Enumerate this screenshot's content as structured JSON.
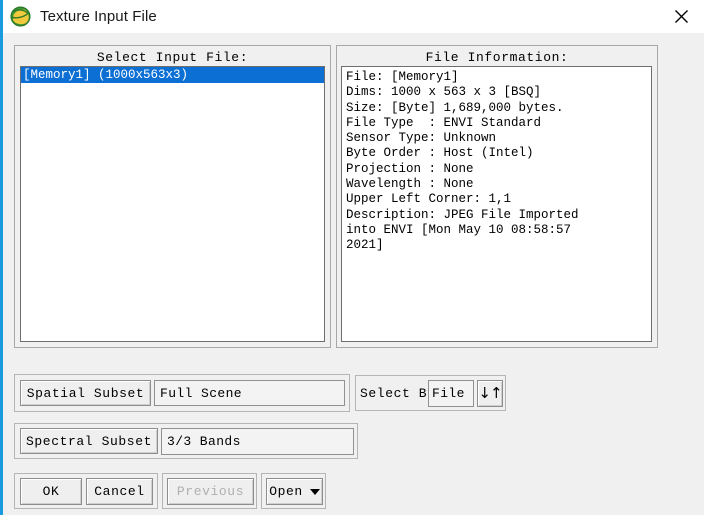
{
  "window": {
    "title": "Texture Input File",
    "icon": "envi-globe-icon",
    "close_label": "×",
    "accent_color": "#1b9ae0",
    "titlebar_bg": "#ffffff",
    "body_bg": "#f0f0f0",
    "selection_color": "#0b6fd4"
  },
  "input_panel": {
    "heading": "Select Input File:",
    "items": [
      {
        "label": "[Memory1] (1000x563x3)",
        "selected": true
      }
    ]
  },
  "info_panel": {
    "heading": "File Information:",
    "lines": [
      "File: [Memory1]",
      "Dims: 1000 x 563 x 3 [BSQ]",
      "Size: [Byte] 1,689,000 bytes.",
      "File Type  : ENVI Standard",
      "Sensor Type: Unknown",
      "Byte Order : Host (Intel)",
      "Projection : None",
      "Wavelength : None",
      "Upper Left Corner: 1,1",
      "Description: JPEG File Imported",
      "into ENVI [Mon May 10 08:58:57",
      "2021]"
    ]
  },
  "spatial_subset": {
    "button_label": "Spatial Subset",
    "value": "Full Scene"
  },
  "select_by": {
    "label": "Select By",
    "value": "File",
    "toggle_icon": "down-up-arrows-icon",
    "toggle_glyph": "↓↑"
  },
  "spectral_subset": {
    "button_label": "Spectral Subset",
    "value": "3/3 Bands"
  },
  "actions": {
    "ok": "OK",
    "cancel": "Cancel",
    "previous": "Previous",
    "previous_disabled": true,
    "open": "Open",
    "open_has_menu": true
  }
}
